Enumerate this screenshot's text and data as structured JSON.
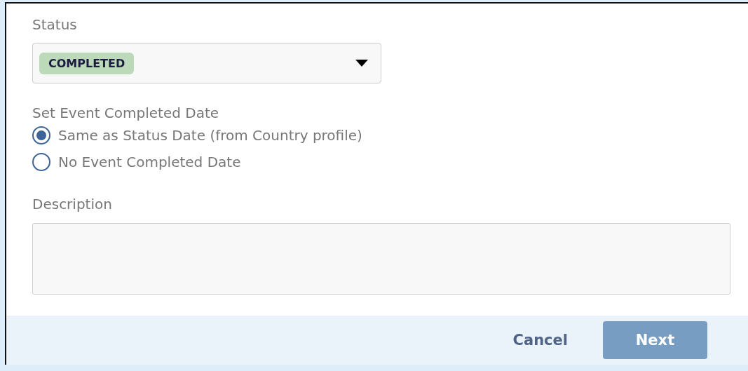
{
  "status": {
    "label": "Status",
    "value": "COMPLETED",
    "color": "#bcdab9"
  },
  "completed_date": {
    "label": "Set Event Completed Date",
    "options": [
      {
        "label": "Same as Status Date (from Country profile)",
        "selected": true
      },
      {
        "label": "No Event Completed Date",
        "selected": false
      }
    ]
  },
  "description": {
    "label": "Description"
  },
  "buttons": {
    "cancel": "Cancel",
    "next": {
      "label": "Next",
      "disabled": true
    }
  }
}
